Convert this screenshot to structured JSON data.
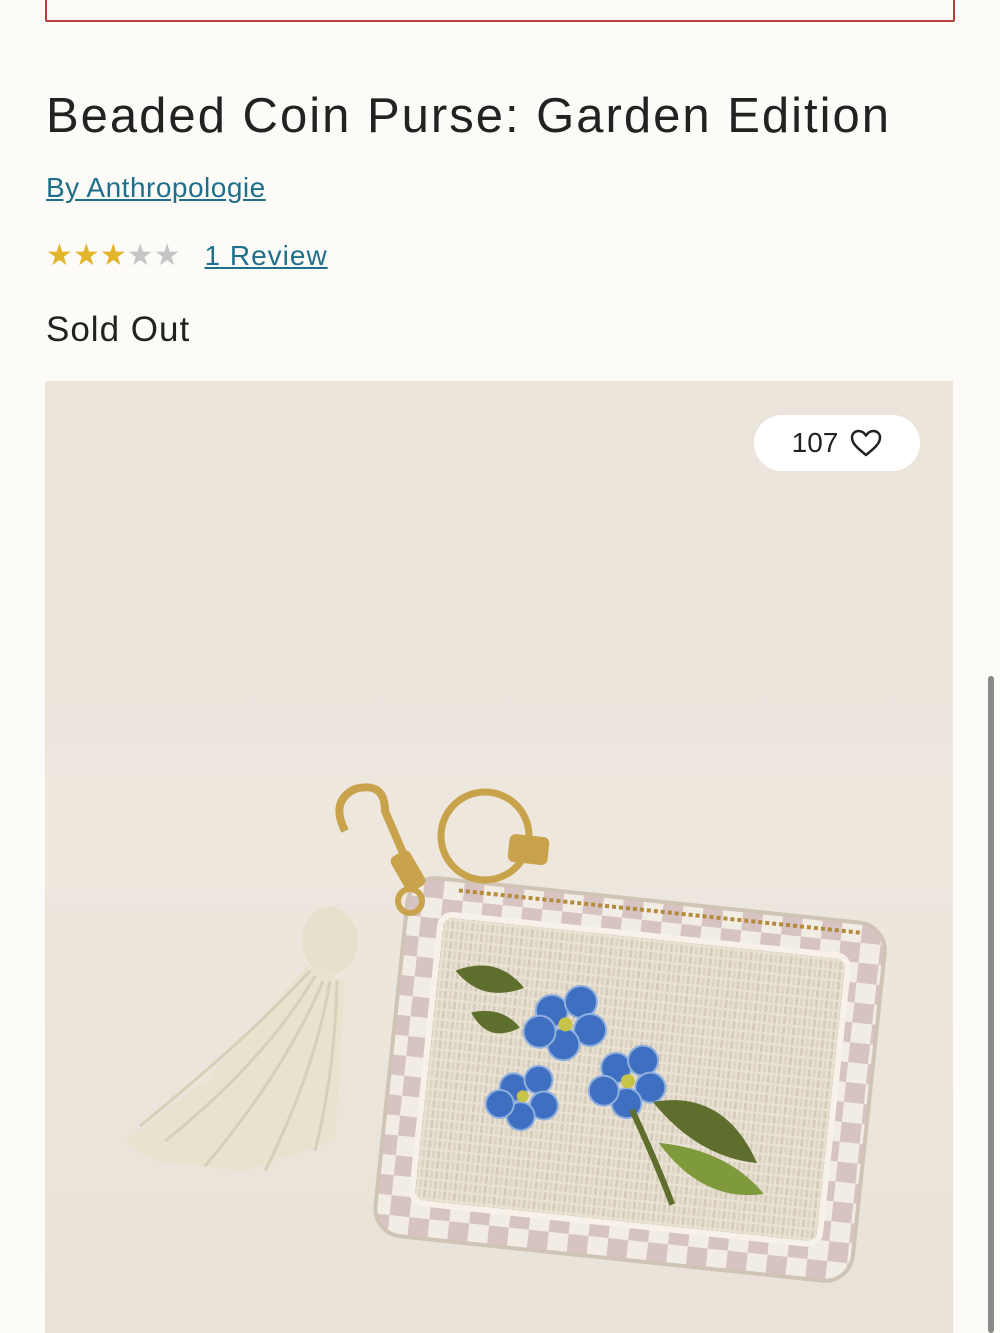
{
  "product": {
    "title": "Beaded Coin Purse: Garden Edition",
    "brand_link": "By Anthropologie",
    "rating": 3,
    "rating_max": 5,
    "reviews_link": "1 Review",
    "availability": "Sold Out"
  },
  "gallery": {
    "favorites_count": "107",
    "favorite_icon": "heart-icon",
    "image_icon": "beaded-coin-purse-photo"
  },
  "colors": {
    "link": "#1f6f8b",
    "star_filled": "#e2b52d",
    "star_empty": "#c6c6c6",
    "top_border": "#b8403f"
  }
}
